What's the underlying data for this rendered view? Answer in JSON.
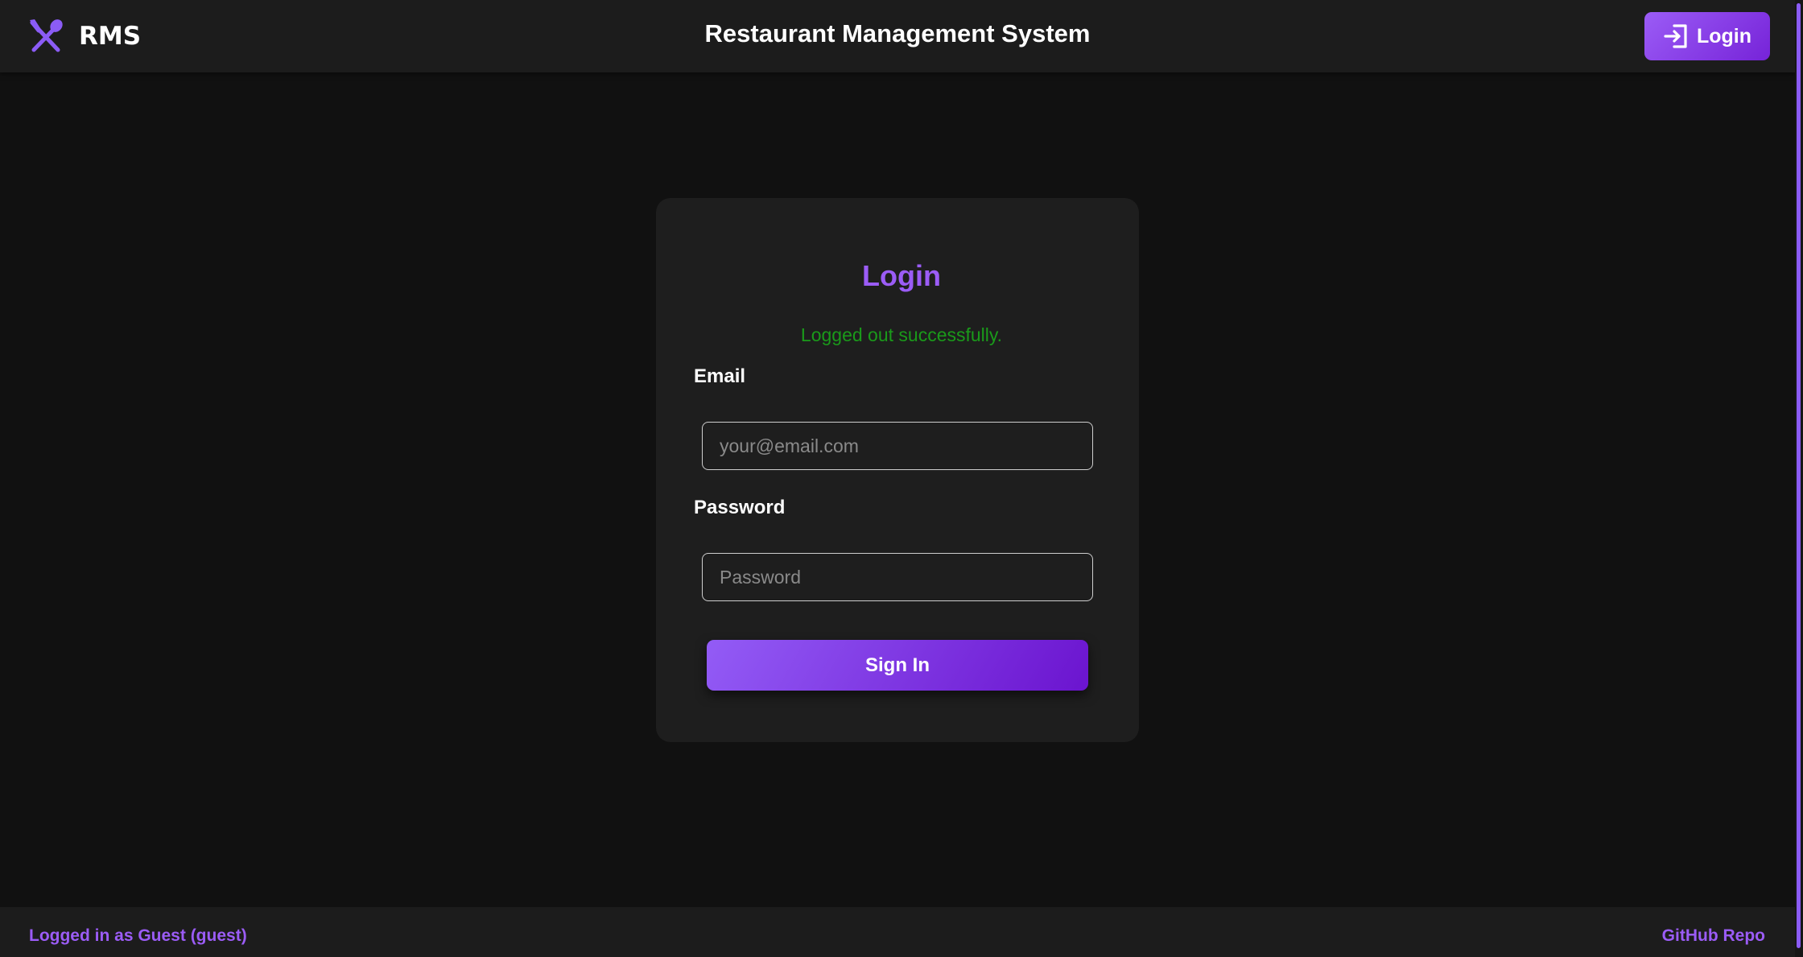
{
  "header": {
    "brand_name": "RMS",
    "brand_icon": "utensils-crossed-icon",
    "title": "Restaurant Management System",
    "login_label": "Login",
    "login_icon": "sign-in-icon"
  },
  "login_card": {
    "title": "Login",
    "flash_message": "Logged out successfully.",
    "email_label": "Email",
    "email_placeholder": "your@email.com",
    "email_value": "",
    "password_label": "Password",
    "password_placeholder": "Password",
    "password_value": "",
    "submit_label": "Sign In"
  },
  "footer": {
    "status_text": "Logged in as Guest (guest)",
    "repo_link_label": "GitHub Repo"
  },
  "colors": {
    "accent": "#9b5cf6",
    "accent_dark": "#6b14cf",
    "background": "#111111",
    "surface": "#1e1e1e",
    "success": "#1a9a1a"
  }
}
